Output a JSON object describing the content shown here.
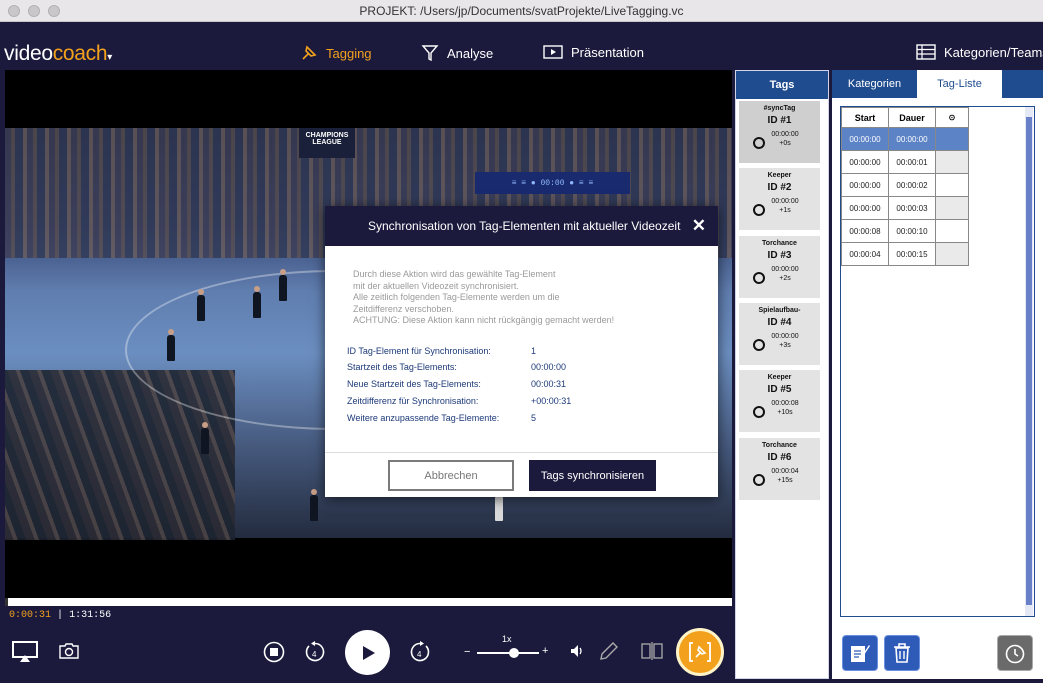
{
  "window": {
    "title": "PROJEKT: /Users/jp/Documents/svatProjekte/LiveTagging.vc"
  },
  "app": {
    "logo_part1": "video",
    "logo_part2": "coach",
    "logo_caret": "▾"
  },
  "nav": {
    "tagging": "Tagging",
    "analyse": "Analyse",
    "praesentation": "Präsentation",
    "kategorien_teams": "Kategorien/Teams"
  },
  "video": {
    "scoreboard": "≡ ≡ ● 00:00 ● ≡ ≡",
    "banner": "CHAMPIONS LEAGUE",
    "current_time": "0:00:31",
    "separator": "|",
    "total_time": "1:31:56",
    "speed_label": "1x",
    "speed_fraction": 0.6,
    "progress_fraction": 0.0
  },
  "tags_panel": {
    "header": "Tags",
    "items": [
      {
        "name": "#syncTag",
        "id": "ID #1",
        "time": "00:00:00",
        "offset": "+0s"
      },
      {
        "name": "Keeper",
        "id": "ID #2",
        "time": "00:00:00",
        "offset": "+1s"
      },
      {
        "name": "Torchance",
        "id": "ID #3",
        "time": "00:00:00",
        "offset": "+2s"
      },
      {
        "name": "Spielaufbau-",
        "id": "ID #4",
        "time": "00:00:00",
        "offset": "+3s"
      },
      {
        "name": "Keeper",
        "id": "ID #5",
        "time": "00:00:08",
        "offset": "+10s"
      },
      {
        "name": "Torchance",
        "id": "ID #6",
        "time": "00:00:04",
        "offset": "+15s"
      }
    ]
  },
  "right_panel": {
    "tab_kategorien": "Kategorien",
    "tab_tagliste": "Tag-Liste",
    "col_start": "Start",
    "col_dauer": "Dauer",
    "col_icon": "⊙",
    "rows": [
      {
        "start": "00:00:00",
        "dauer": "00:00:00"
      },
      {
        "start": "00:00:00",
        "dauer": "00:00:01"
      },
      {
        "start": "00:00:00",
        "dauer": "00:00:02"
      },
      {
        "start": "00:00:00",
        "dauer": "00:00:03"
      },
      {
        "start": "00:00:08",
        "dauer": "00:00:10"
      },
      {
        "start": "00:00:04",
        "dauer": "00:00:15"
      }
    ]
  },
  "modal": {
    "title": "Synchronisation von Tag-Elementen mit aktueller Videozeit",
    "close": "✕",
    "warning_lines": [
      "Durch diese Aktion wird das gewählte Tag-Element",
      "mit der aktuellen Videozeit synchronisiert.",
      "Alle zeitlich folgenden Tag-Elemente werden um die",
      "Zeitdifferenz verschoben.",
      "ACHTUNG: Diese Aktion kann nicht rückgängig gemacht werden!"
    ],
    "fields": [
      {
        "label": "ID Tag-Element für Synchronisation:",
        "value": "1"
      },
      {
        "label": "Startzeit des Tag-Elements:",
        "value": "00:00:00"
      },
      {
        "label": "Neue Startzeit des Tag-Elements:",
        "value": "00:00:31"
      },
      {
        "label": "Zeitdifferenz für Synchronisation:",
        "value": "+00:00:31"
      },
      {
        "label": "Weitere anzupassende Tag-Elemente:",
        "value": "5"
      }
    ],
    "cancel": "Abbrechen",
    "confirm": "Tags synchronisieren"
  },
  "colors": {
    "accent": "#f3a11d",
    "panel_blue": "#1f4c8f",
    "dark_bg": "#1b1a3c",
    "selected_row": "#5d83c7"
  }
}
